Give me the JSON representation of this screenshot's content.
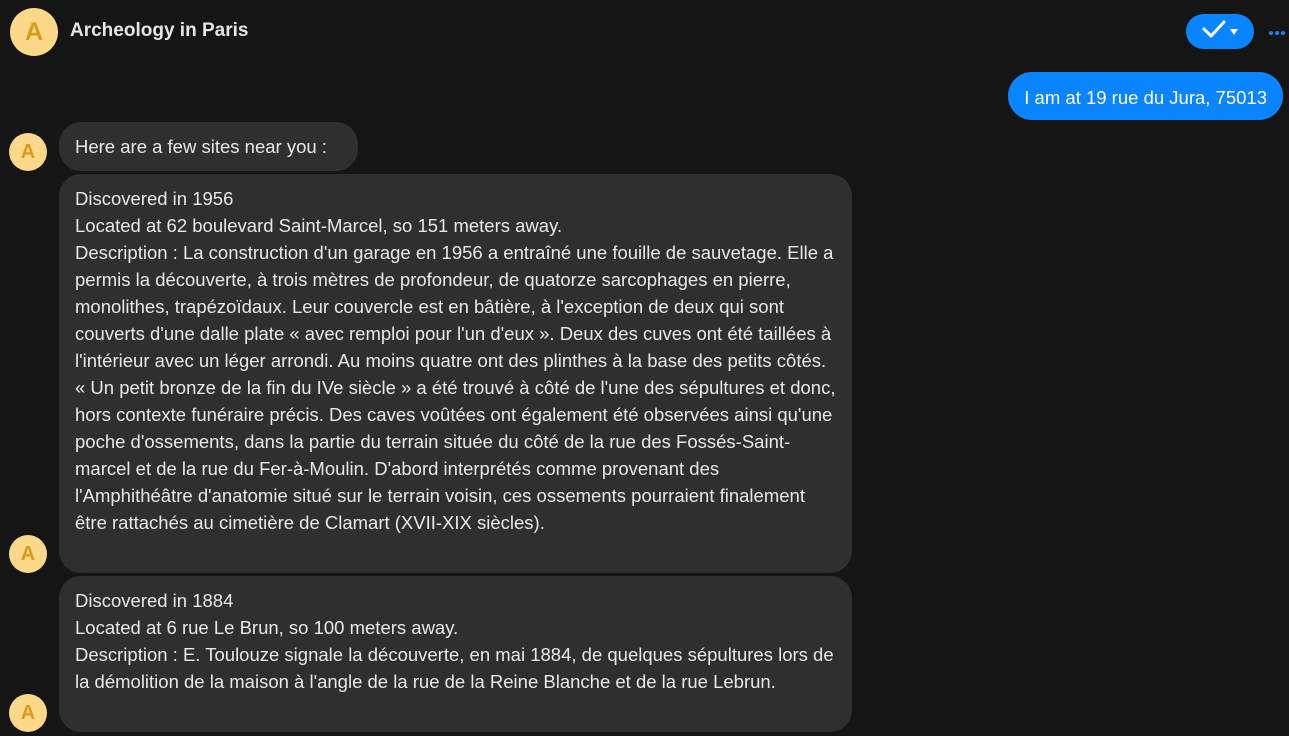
{
  "header": {
    "avatar_letter": "A",
    "title": "Archeology in Paris",
    "check_icon": "check-icon",
    "dropdown_icon": "caret-down-icon",
    "more_icon": "more-dots-icon",
    "accent_color": "#0a84ff"
  },
  "messages": {
    "user": {
      "text": "I am at 19 rue du Jura, 75013"
    },
    "bot_avatar_letter": "A",
    "intro": {
      "text": "Here are a few sites near you :"
    },
    "site1": {
      "discovered": "Discovered in 1956",
      "location": "Located at 62 boulevard Saint-Marcel, so 151 meters away.",
      "description": "Description : La construction d'un garage en 1956 a entraîné une fouille de sauvetage. Elle a permis la découverte, à trois mètres de profondeur, de quatorze sarcophages en pierre, monolithes, trapézoïdaux. Leur couvercle est en bâtière, à l'exception de deux qui sont couverts d'une dalle plate « avec remploi pour l'un d'eux ». Deux des cuves ont été taillées à l'intérieur avec un léger arrondi. Au moins quatre ont des plinthes à la base des petits côtés. « Un petit bronze de la fin du IVe siècle » a été trouvé à côté de l'une des sépultures et donc, hors contexte funéraire précis. Des caves voûtées ont également été observées ainsi qu'une poche d'ossements, dans la partie du terrain située du côté de la rue des Fossés-Saint-marcel et de la rue du Fer-à-Moulin. D'abord interprétés comme provenant des l'Amphithéâtre d'anatomie situé sur le terrain voisin, ces ossements pourraient finalement être rattachés au cimetière de Clamart (XVII-XIX siècles)."
    },
    "site2": {
      "discovered": "Discovered in 1884",
      "location": "Located at 6 rue Le Brun, so 100 meters away.",
      "description": "Description : E. Toulouze signale la découverte, en mai 1884, de quelques sépultures lors de la démolition de la maison à l'angle de la rue de la Reine Blanche et de la rue Lebrun."
    }
  }
}
